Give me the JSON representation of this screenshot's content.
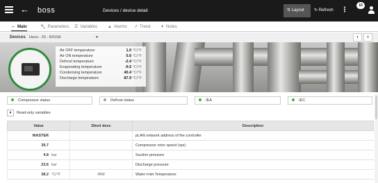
{
  "header": {
    "logo": "boss",
    "title": "Devices / device detail",
    "layout_label": "Layout",
    "refresh_label": "Refresh",
    "notification_count": "10"
  },
  "tabs": [
    {
      "label": "Main",
      "icon": "arrows-icon"
    },
    {
      "label": "Parameters",
      "icon": "wrench-icon"
    },
    {
      "label": "Variables",
      "icon": "list-icon"
    },
    {
      "label": "Alarms",
      "icon": "warning-icon"
    },
    {
      "label": "Trend",
      "icon": "trend-icon"
    },
    {
      "label": "Notes",
      "icon": "pin-icon"
    }
  ],
  "devices": {
    "label": "Devices",
    "selected": "Heos - 20 - R410A"
  },
  "readings": [
    {
      "label": "Air OFF temperature",
      "value": "1.0",
      "unit": "°C/°F"
    },
    {
      "label": "Air ON temperature",
      "value": "5.6",
      "unit": "°C/°F"
    },
    {
      "label": "Defrost temperature",
      "value": "-2.4",
      "unit": "°C/°F"
    },
    {
      "label": "Evaporating temperature",
      "value": "-9.5",
      "unit": "°C/°F"
    },
    {
      "label": "Condensing temperature",
      "value": "40.4",
      "unit": "°C/°F"
    },
    {
      "label": "Discharge temperature",
      "value": "87.9",
      "unit": "°C/°F"
    }
  ],
  "statuses": [
    {
      "label": "Compressor status",
      "color": "#3cb043"
    },
    {
      "label": "Defrost status",
      "color": "#9e9e9e"
    },
    {
      "label": "/EA",
      "color": "#3cb043"
    },
    {
      "label": "/EC",
      "color": "#3cb043"
    }
  ],
  "readonly_label": "Read-only variables",
  "table": {
    "columns": [
      "Value",
      "Short desc",
      "Description"
    ],
    "rows": [
      {
        "value": "MASTER",
        "unit": "",
        "short": "",
        "desc": "pLAN network address of the controller"
      },
      {
        "value": "39.7",
        "unit": "",
        "short": "",
        "desc": "Compressor rotor speed (rps)"
      },
      {
        "value": "4.8",
        "unit": "bar",
        "short": "",
        "desc": "Suction pressure"
      },
      {
        "value": "23.6",
        "unit": "bar",
        "short": "",
        "desc": "Discharge pressure"
      },
      {
        "value": "38.2",
        "unit": "°C/°F",
        "short": "/RW",
        "desc": "Water Inlet Temperature"
      }
    ]
  }
}
